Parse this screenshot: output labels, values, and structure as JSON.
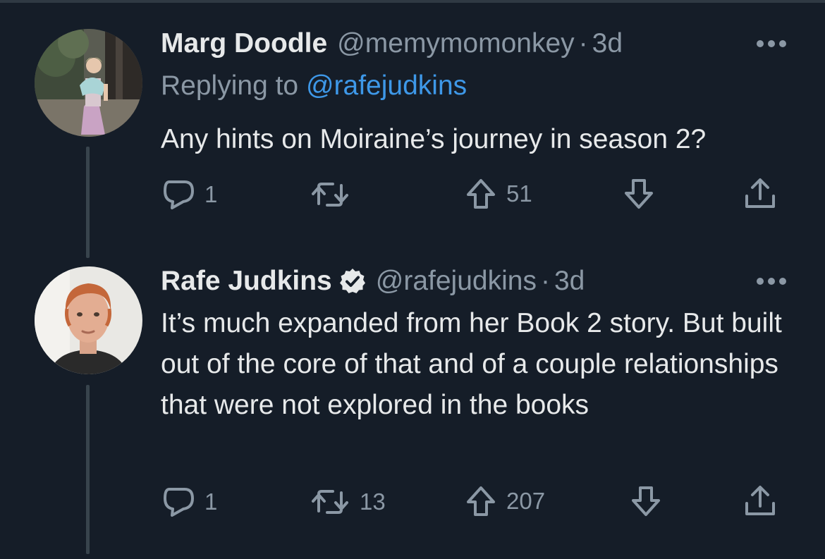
{
  "tweets": [
    {
      "name": "Marg Doodle",
      "handle": "@memymomonkey",
      "separator": "·",
      "time": "3d",
      "replying_prefix": "Replying to ",
      "replying_to": "@rafejudkins",
      "text": "Any hints on Moiraine’s journey in season 2?",
      "replies": "1",
      "retweets": "",
      "upvotes": "51",
      "avatar_icon": "woman-in-dress-photo"
    },
    {
      "name": "Rafe Judkins",
      "verified": true,
      "handle": "@rafejudkins",
      "separator": "·",
      "time": "3d",
      "text": "It’s much expanded from her Book 2 story. But built out of the core of that and of a couple relationships that were not explored in the books",
      "replies": "1",
      "retweets": "13",
      "upvotes": "207",
      "avatar_icon": "red-haired-man-photo"
    }
  ],
  "colors": {
    "background": "#151d28",
    "text": "#e7e9ea",
    "muted": "#8b98a5",
    "link": "#3e98e8",
    "thread_line": "#38444d"
  },
  "icons": [
    "reply-icon",
    "retweet-icon",
    "upvote-icon",
    "downvote-icon",
    "share-icon",
    "more-icon",
    "verified-badge-icon"
  ]
}
